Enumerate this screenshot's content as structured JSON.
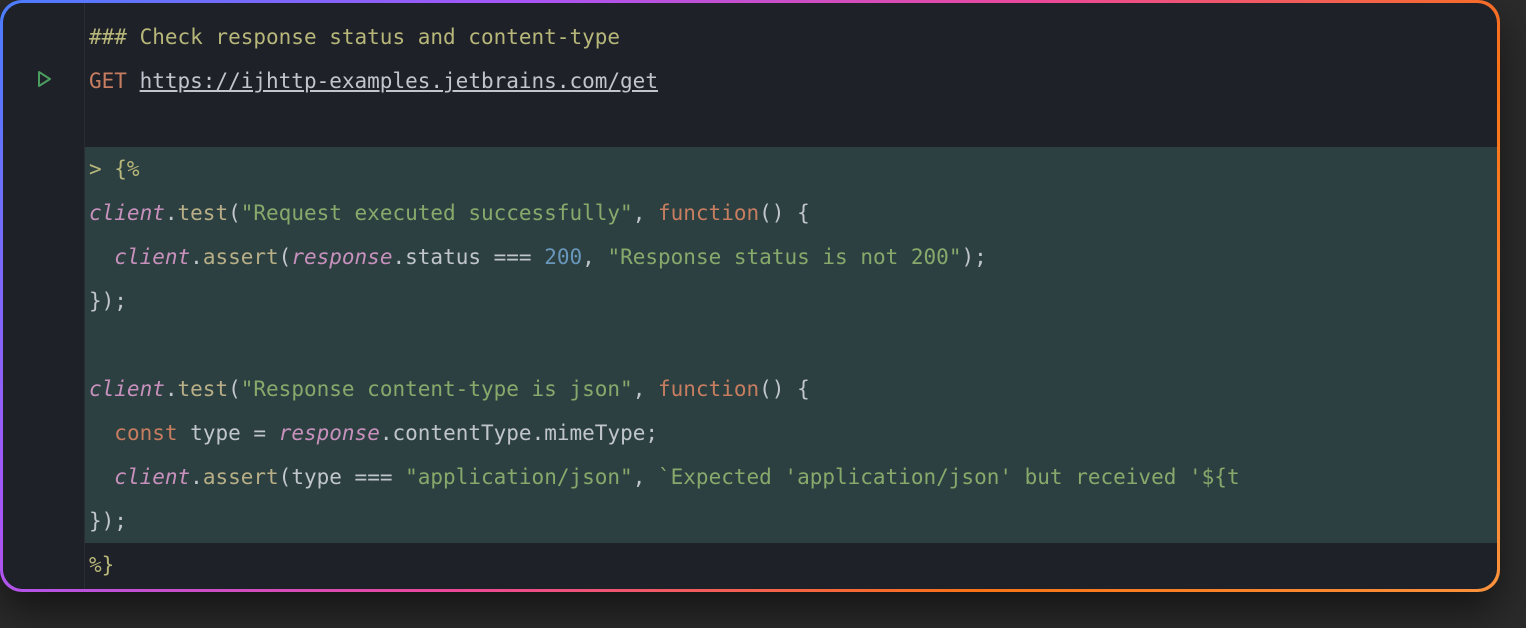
{
  "code": {
    "line1": {
      "comment_prefix": "### ",
      "comment_text": "Check response status and content-type"
    },
    "line2": {
      "method": "GET",
      "url": "https://ijhttp-examples.jetbrains.com/get"
    },
    "line4": {
      "open": "> {%"
    },
    "line5": {
      "obj1": "client",
      "dot1": ".",
      "func1": "test",
      "open_paren": "(",
      "str1": "\"Request executed successfully\"",
      "comma": ", ",
      "kw_function": "function",
      "rest": "() {"
    },
    "line6": {
      "indent": "  ",
      "obj1": "client",
      "dot1": ".",
      "func1": "assert",
      "open_paren": "(",
      "obj2": "response",
      "dot2": ".",
      "prop": "status",
      "op": " === ",
      "num": "200",
      "comma": ", ",
      "str1": "\"Response status is not 200\"",
      "close": ");"
    },
    "line7": {
      "close": "});"
    },
    "line9": {
      "obj1": "client",
      "dot1": ".",
      "func1": "test",
      "open_paren": "(",
      "str1": "\"Response content-type is json\"",
      "comma": ", ",
      "kw_function": "function",
      "rest": "() {"
    },
    "line10": {
      "indent": "  ",
      "kw_const": "const",
      "sp1": " ",
      "var": "type",
      "eq": " = ",
      "obj1": "response",
      "dot1": ".",
      "prop1": "contentType",
      "dot2": ".",
      "prop2": "mimeType",
      "semi": ";"
    },
    "line11": {
      "indent": "  ",
      "obj1": "client",
      "dot1": ".",
      "func1": "assert",
      "open_paren": "(",
      "var": "type",
      "op": " === ",
      "str1": "\"application/json\"",
      "comma": ", ",
      "str2": "`Expected 'application/json' but received '${t"
    },
    "line12": {
      "close": "});"
    },
    "line13": {
      "close_delim": "%}"
    }
  },
  "icons": {
    "run": "run-icon"
  }
}
